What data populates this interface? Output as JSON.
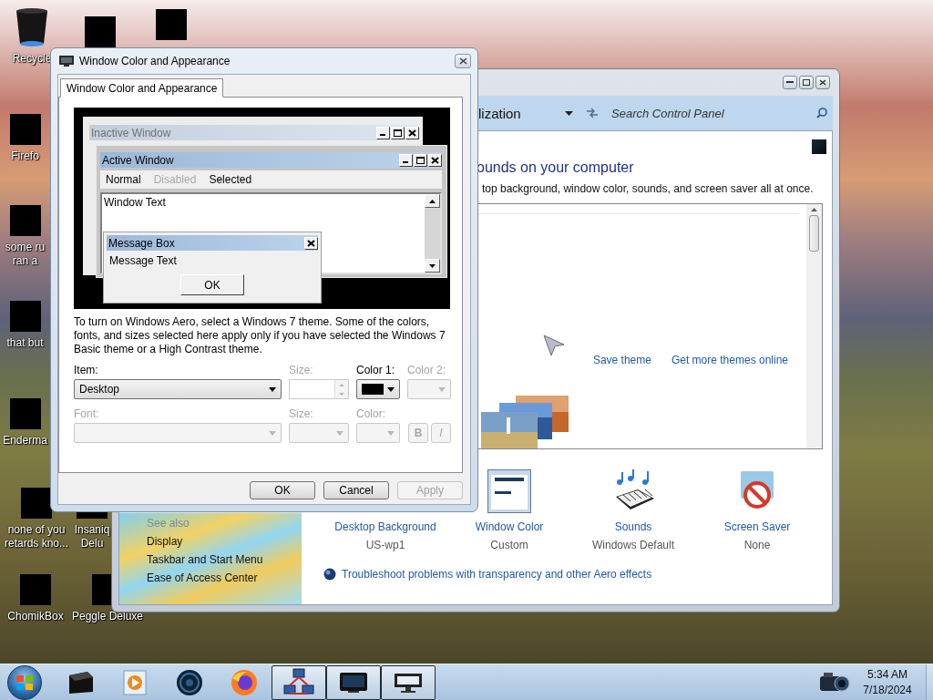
{
  "desktop_icons": [
    {
      "kind": "recycle-bin",
      "label": "Recycle"
    },
    {
      "kind": "blacked-out"
    },
    {
      "kind": "blacked-out"
    },
    {
      "kind": "blacked-out",
      "label": "Firefo"
    },
    {
      "kind": "blacked-out",
      "label": "some ru\nran a"
    },
    {
      "kind": "blacked-out",
      "label": "that but"
    },
    {
      "kind": "blacked-out",
      "label": "Enderma"
    },
    {
      "kind": "blacked-out",
      "label": "none of you\nretards kno..."
    },
    {
      "kind": "blacked-out",
      "label": "Insaniq\nDelu"
    },
    {
      "kind": "blacked-out",
      "label": "ChomikBox"
    },
    {
      "kind": "blacked-out",
      "label": "Peggle Deluxe"
    }
  ],
  "control_panel": {
    "breadcrumb": "lization",
    "search": {
      "placeholder": "Search Control Panel"
    },
    "heading": "ounds on your computer",
    "description": "top background, window color, sounds, and screen saver all at once.",
    "theme_links": [
      "Save theme",
      "Get more themes online"
    ],
    "settings": [
      {
        "kind": "background",
        "label": "Desktop Background",
        "value": "US-wp1"
      },
      {
        "kind": "window-color",
        "label": "Window Color",
        "value": "Custom"
      },
      {
        "kind": "sounds",
        "label": "Sounds",
        "value": "Windows Default"
      },
      {
        "kind": "screen-saver",
        "label": "Screen Saver",
        "value": "None"
      }
    ],
    "troubleshoot": "Troubleshoot problems with transparency and other Aero effects",
    "see_also": {
      "title": "See also",
      "links": [
        "Display",
        "Taskbar and Start Menu",
        "Ease of Access Center"
      ]
    }
  },
  "dialog": {
    "title": "Window Color and Appearance",
    "tabs": [
      {
        "label": "Window Color and Appearance",
        "selected": true
      }
    ],
    "preview": {
      "inactive_title": "Inactive Window",
      "active_title": "Active Window",
      "menu": [
        {
          "label": "Normal",
          "disabled": false
        },
        {
          "label": "Disabled",
          "disabled": true
        },
        {
          "label": "Selected",
          "disabled": false
        }
      ],
      "window_text": "Window Text",
      "message_title": "Message Box",
      "message_text": "Message Text",
      "message_button": "OK"
    },
    "description": "To turn on Windows Aero, select a Windows 7 theme. Some of the colors, fonts, and sizes selected here apply only if you have selected the Windows 7 Basic theme or a High Contrast theme.",
    "rows": [
      [
        {
          "kind": "dropdown",
          "label": "Item:",
          "value": "Desktop",
          "disabled": false
        },
        {
          "kind": "spinner",
          "label": "Size:",
          "disabled": true
        },
        {
          "kind": "color",
          "label": "Color 1:",
          "color": "#000000",
          "disabled": false
        },
        {
          "kind": "color",
          "label": "Color 2:",
          "disabled": true
        }
      ],
      [
        {
          "kind": "dropdown",
          "label": "Font:",
          "disabled": true
        },
        {
          "kind": "dropdown",
          "label": "Size:",
          "disabled": true
        },
        {
          "kind": "color",
          "label": "Color:",
          "disabled": true
        },
        {
          "kind": "style-buttons",
          "disabled": true,
          "buttons": [
            {
              "kind": "bold",
              "label": "B"
            },
            {
              "kind": "italic",
              "label": "I"
            }
          ]
        }
      ]
    ],
    "buttons": [
      {
        "label": "OK",
        "disabled": false
      },
      {
        "label": "Cancel",
        "disabled": false
      },
      {
        "label": "Apply",
        "disabled": true
      }
    ]
  },
  "taskbar": {
    "items": [
      {
        "kind": "device",
        "active": false
      },
      {
        "kind": "media-player",
        "active": false
      },
      {
        "kind": "globe",
        "active": false
      },
      {
        "kind": "browser",
        "active": false
      },
      {
        "kind": "network",
        "active": true
      },
      {
        "kind": "display",
        "active": true
      },
      {
        "kind": "monitor",
        "active": true
      }
    ],
    "time": "5:34 AM",
    "date": "7/18/2024"
  }
}
